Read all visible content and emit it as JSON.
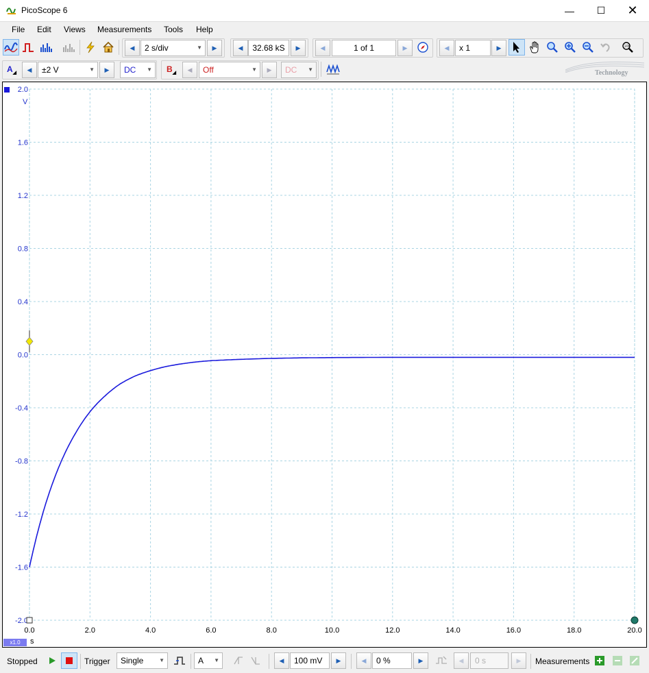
{
  "window": {
    "title": "PicoScope 6"
  },
  "menu": [
    "File",
    "Edit",
    "Views",
    "Measurements",
    "Tools",
    "Help"
  ],
  "toolbar1": {
    "timebase": "2 s/div",
    "samples": "32.68 kS",
    "buffer": "1 of 1",
    "zoom": "x 1",
    "icons": [
      "scope-mode-icon",
      "persistence-mode-icon",
      "spectrum-mode-icon",
      "spectrum-alt-icon",
      "auto-setup-icon",
      "home-icon",
      "compass-icon",
      "select-cursor-icon",
      "hand-pan-icon",
      "zoom-icon",
      "zoom-in-icon",
      "zoom-out-icon",
      "undo-zoom-icon",
      "zoom-overview-icon"
    ]
  },
  "toolbar2": {
    "channel_a": {
      "label": "A",
      "range": "±2 V",
      "coupling": "DC",
      "color": "#2222cc"
    },
    "channel_b": {
      "label": "B",
      "range": "Off",
      "coupling": "DC",
      "color": "#cc2222"
    }
  },
  "branding": {
    "watermark": "Technology"
  },
  "chart_data": {
    "type": "line",
    "title": "",
    "xlabel": "s",
    "ylabel": "V",
    "x_ticks": [
      "0.0",
      "2.0",
      "4.0",
      "6.0",
      "8.0",
      "10.0",
      "12.0",
      "14.0",
      "16.0",
      "18.0",
      "20.0"
    ],
    "y_ticks": [
      "2.0",
      "1.6",
      "1.2",
      "0.8",
      "0.4",
      "0.0",
      "-0.4",
      "-0.8",
      "-1.2",
      "-1.6",
      "-2.0"
    ],
    "xlim": [
      0,
      20
    ],
    "ylim": [
      -2.0,
      2.0
    ],
    "x_zoom_label": "x1.0",
    "grid": true,
    "series": [
      {
        "color": "#1a1adc",
        "x": [
          0.0,
          0.5,
          1.0,
          1.5,
          2.0,
          2.5,
          3.0,
          3.5,
          4.0,
          4.5,
          5.0,
          5.5,
          6.0,
          7.0,
          8.0,
          9.0,
          10.0,
          12.0,
          14.0,
          16.0,
          18.0,
          20.0
        ],
        "y": [
          -1.6,
          -1.15,
          -0.83,
          -0.6,
          -0.43,
          -0.31,
          -0.22,
          -0.16,
          -0.12,
          -0.09,
          -0.07,
          -0.055,
          -0.045,
          -0.035,
          -0.028,
          -0.024,
          -0.022,
          -0.02,
          -0.02,
          -0.02,
          -0.02,
          -0.02
        ]
      }
    ],
    "trigger_marker": {
      "x": 0.0,
      "y": 0.1,
      "color": "#f2e800"
    }
  },
  "statusbar": {
    "run_state": "Stopped",
    "trigger_label": "Trigger",
    "trigger_mode": "Single",
    "trigger_channel": "A",
    "threshold": "100 mV",
    "pre_trigger": "0 %",
    "delay": "0 s",
    "measurements_label": "Measurements"
  }
}
